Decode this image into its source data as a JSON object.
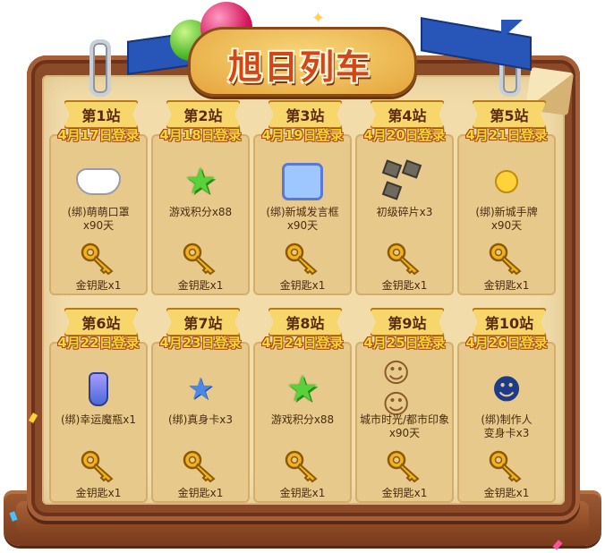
{
  "title": "旭日列车",
  "stations": [
    {
      "flag": "第1站",
      "date": "4月17日登录",
      "item_icon": "mask-icon",
      "item": "(绑)萌萌口罩\nx90天",
      "reward": "金钥匙x1"
    },
    {
      "flag": "第2站",
      "date": "4月18日登录",
      "item_icon": "green-star-icon",
      "item": "游戏积分x88",
      "reward": "金钥匙x1"
    },
    {
      "flag": "第3站",
      "date": "4月19日登录",
      "item_icon": "chat-frame-icon",
      "item": "(绑)新城发言框\nx90天",
      "reward": "金钥匙x1"
    },
    {
      "flag": "第4站",
      "date": "4月20日登录",
      "item_icon": "stone-shards-icon",
      "item": "初级碎片x3",
      "reward": "金钥匙x1"
    },
    {
      "flag": "第5站",
      "date": "4月21日登录",
      "item_icon": "hand-sign-icon",
      "item": "(绑)新城手牌\nx90天",
      "reward": "金钥匙x1"
    },
    {
      "flag": "第6站",
      "date": "4月22日登录",
      "item_icon": "magic-bottle-icon",
      "item": "(绑)幸运魔瓶x1",
      "reward": "金钥匙x1"
    },
    {
      "flag": "第7站",
      "date": "4月23日登录",
      "item_icon": "body-card-icon",
      "item": "(绑)真身卡x3",
      "reward": "金钥匙x1"
    },
    {
      "flag": "第8站",
      "date": "4月24日登录",
      "item_icon": "green-star-icon",
      "item": "游戏积分x88",
      "reward": "金钥匙x1"
    },
    {
      "flag": "第9站",
      "date": "4月25日登录",
      "item_icon": "couple-avatar-icon",
      "item": "城市时光/都市印象\nx90天",
      "reward": "金钥匙x1"
    },
    {
      "flag": "第10站",
      "date": "4月26日登录",
      "item_icon": "producer-avatar-icon",
      "item": "(绑)制作人\n变身卡x3",
      "reward": "金钥匙x1"
    }
  ],
  "colors": {
    "board": "#8b4a28",
    "paper": "#f1dcaa",
    "card": "#e8c98c",
    "date_text": "#f8d23a",
    "title_text": "#d2461c"
  }
}
